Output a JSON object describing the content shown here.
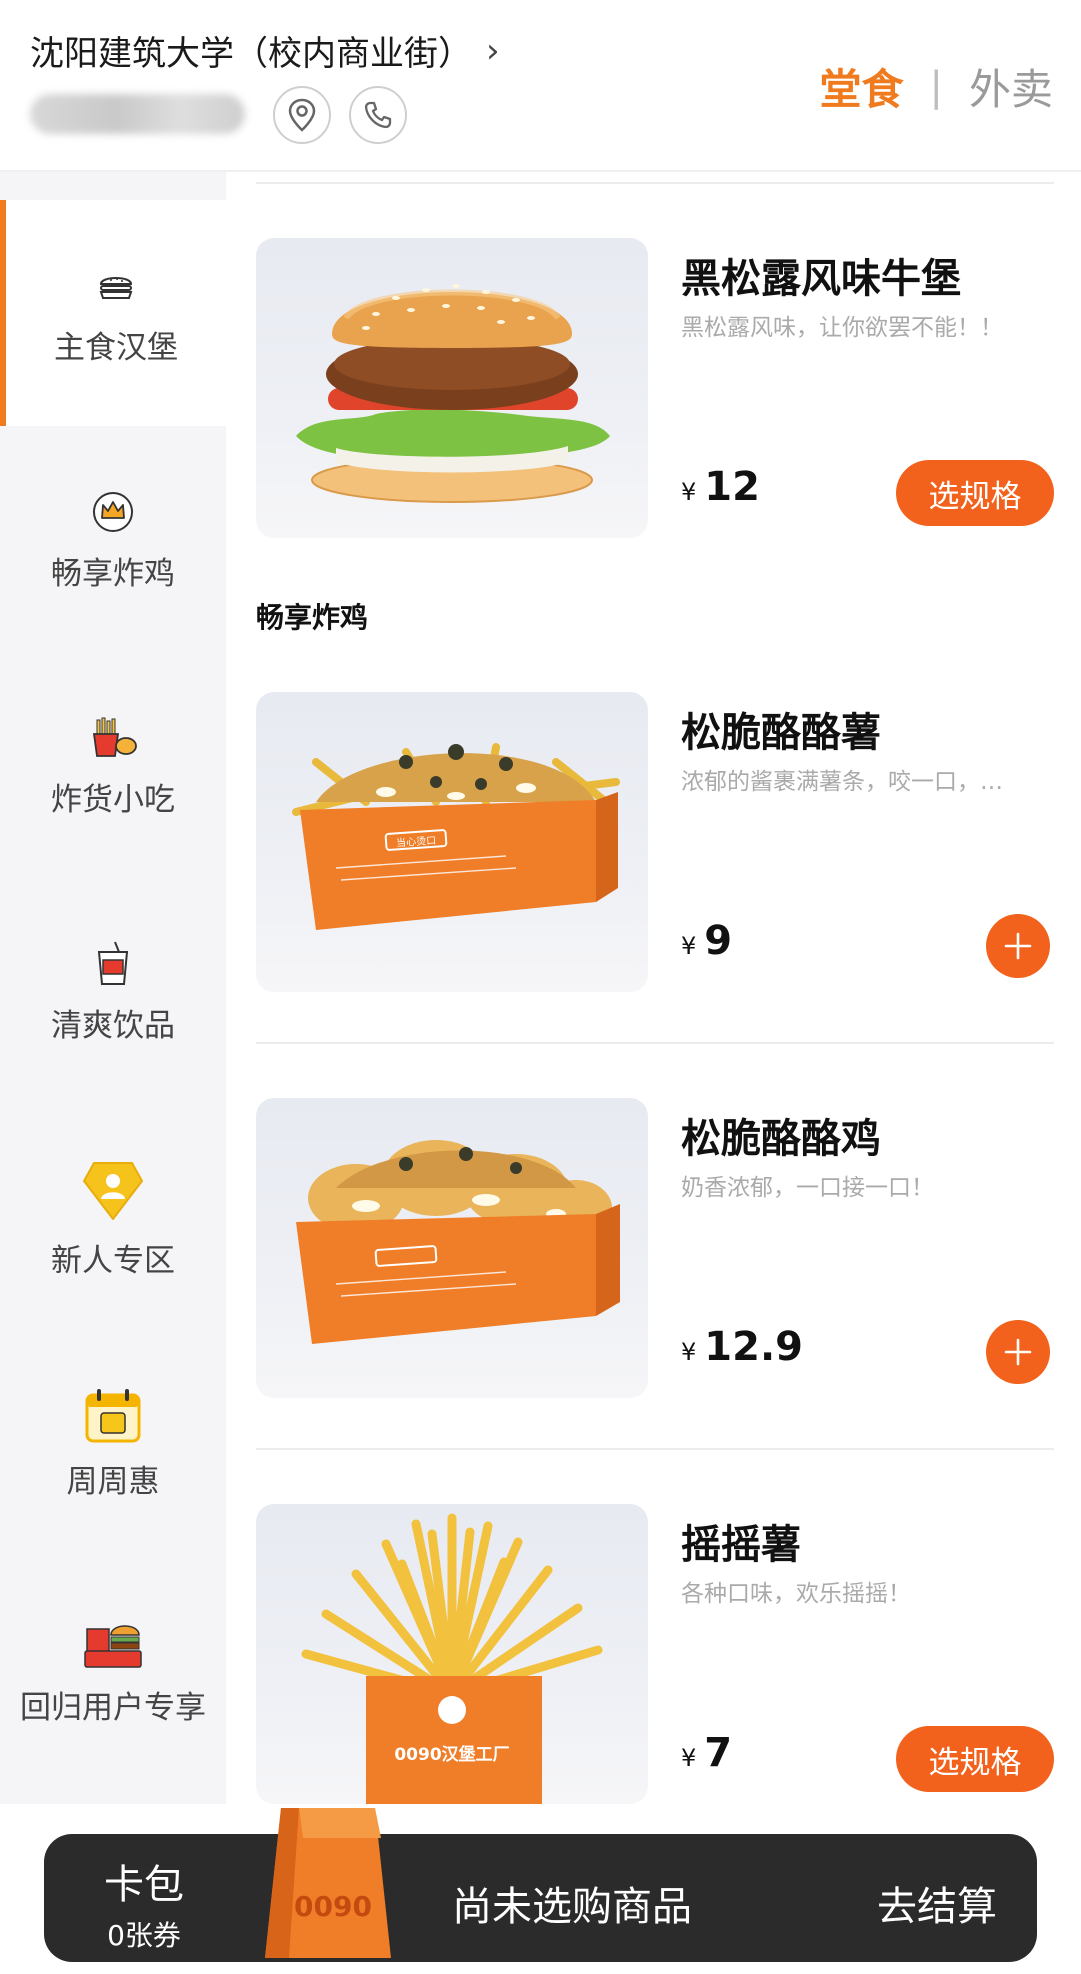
{
  "header": {
    "store_name": "沈阳建筑大学（校内商业街）",
    "store_chevron": "›",
    "mode_active": "堂食",
    "mode_separator": "|",
    "mode_inactive": "外卖"
  },
  "sidebar": {
    "items": [
      {
        "label": "主食汉堡",
        "icon": "burger-icon",
        "active": true
      },
      {
        "label": "畅享炸鸡",
        "icon": "crown-icon",
        "active": false
      },
      {
        "label": "炸货小吃",
        "icon": "fries-icon",
        "active": false
      },
      {
        "label": "清爽饮品",
        "icon": "drink-icon",
        "active": false
      },
      {
        "label": "新人专区",
        "icon": "new-user-badge-icon",
        "active": false
      },
      {
        "label": "周周惠",
        "icon": "calendar-deal-icon",
        "active": false
      },
      {
        "label": "回归用户专享",
        "icon": "returning-user-icon",
        "active": false
      }
    ]
  },
  "menu": {
    "section_chicken": "畅享炸鸡",
    "items": [
      {
        "name": "黑松露风味牛堡",
        "desc": "黑松露风味，让你欲罢不能！！",
        "currency": "¥",
        "price": "12",
        "action": "选规格"
      },
      {
        "name": "松脆酪酪薯",
        "desc": "浓郁的酱裹满薯条，咬一口，…",
        "currency": "¥",
        "price": "9",
        "action": "+"
      },
      {
        "name": "松脆酪酪鸡",
        "desc": "奶香浓郁，一口接一口！",
        "currency": "¥",
        "price": "12.9",
        "action": "+"
      },
      {
        "name": "摇摇薯",
        "desc": "各种口味，欢乐摇摇！",
        "currency": "¥",
        "price": "7",
        "action": "选规格"
      }
    ],
    "box_brand_text": "当心烫口",
    "cup_brand_text": "0090汉堡工厂"
  },
  "cart": {
    "wallet_title": "卡包",
    "wallet_count": "0张券",
    "bag_text": "0090",
    "status": "尚未选购商品",
    "checkout": "去结算"
  },
  "colors": {
    "accent": "#f07b1f",
    "button": "#f2621d",
    "cart_bg": "#2b2b2b"
  }
}
